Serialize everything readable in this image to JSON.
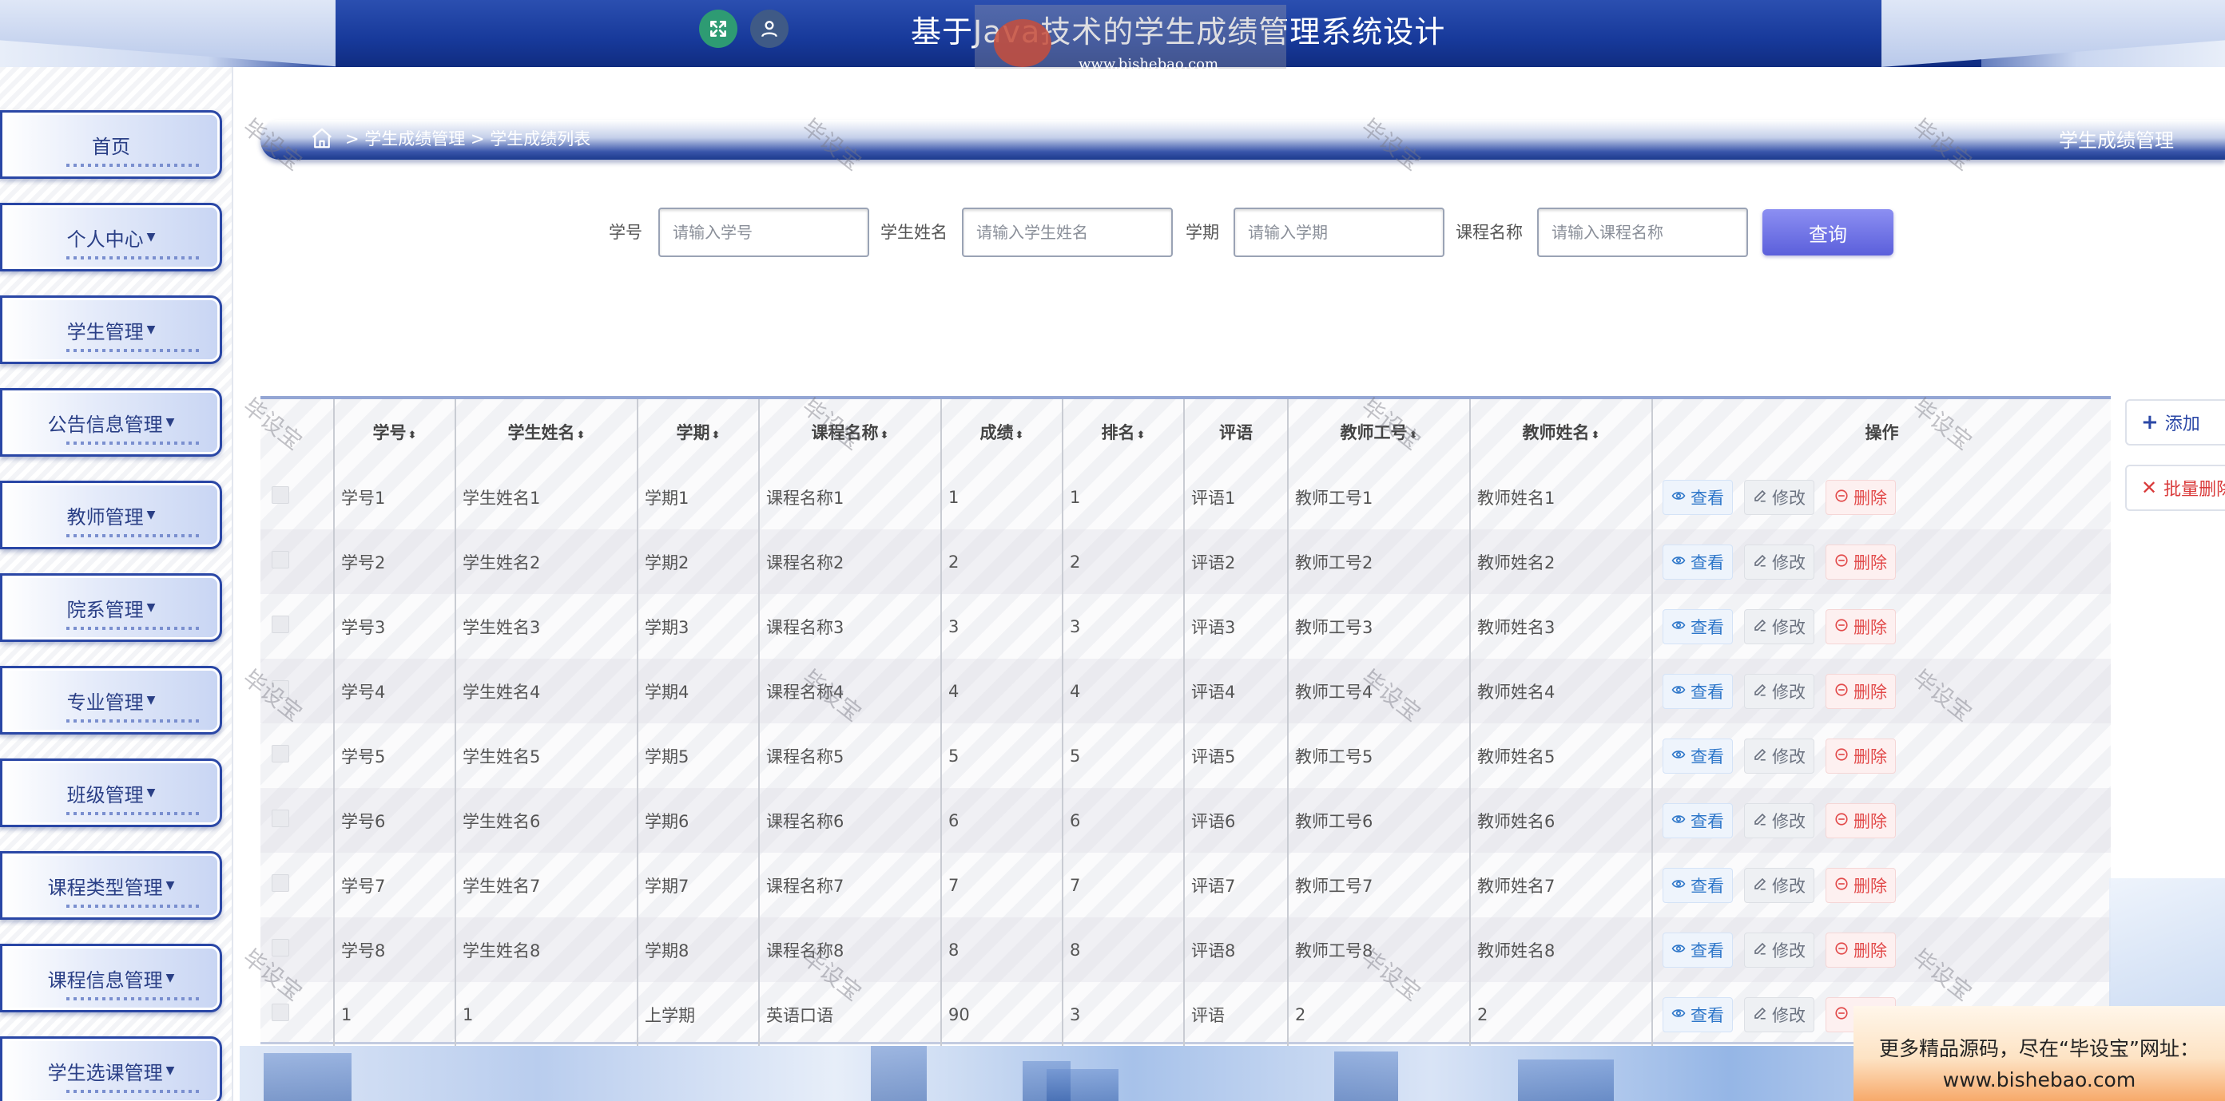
{
  "header": {
    "title": "基于Java技术的学生成绩管理系统设计",
    "watermark_url": "www.bishebao.com"
  },
  "sidebar": {
    "items": [
      {
        "label": "首页",
        "has_caret": false
      },
      {
        "label": "个人中心",
        "has_caret": true
      },
      {
        "label": "学生管理",
        "has_caret": true
      },
      {
        "label": "公告信息管理",
        "has_caret": true
      },
      {
        "label": "教师管理",
        "has_caret": true
      },
      {
        "label": "院系管理",
        "has_caret": true
      },
      {
        "label": "专业管理",
        "has_caret": true
      },
      {
        "label": "班级管理",
        "has_caret": true
      },
      {
        "label": "课程类型管理",
        "has_caret": true
      },
      {
        "label": "课程信息管理",
        "has_caret": true
      },
      {
        "label": "学生选课管理",
        "has_caret": true
      }
    ]
  },
  "breadcrumb": {
    "path": "> 学生成绩管理 > 学生成绩列表",
    "title": "学生成绩管理"
  },
  "search": {
    "fields": [
      {
        "label": "学号",
        "placeholder": "请输入学号",
        "value": ""
      },
      {
        "label": "学生姓名",
        "placeholder": "请输入学生姓名",
        "value": ""
      },
      {
        "label": "学期",
        "placeholder": "请输入学期",
        "value": ""
      },
      {
        "label": "课程名称",
        "placeholder": "请输入课程名称",
        "value": ""
      }
    ],
    "query_label": "查询"
  },
  "actions": {
    "add_label": "添加",
    "batch_delete_label": "批量删除"
  },
  "table": {
    "columns": [
      "学号",
      "学生姓名",
      "学期",
      "课程名称",
      "成绩",
      "排名",
      "评语",
      "教师工号",
      "教师姓名",
      "操作"
    ],
    "sortable": [
      true,
      true,
      true,
      true,
      true,
      true,
      false,
      true,
      true,
      false
    ],
    "rows": [
      [
        "学号1",
        "学生姓名1",
        "学期1",
        "课程名称1",
        "1",
        "1",
        "评语1",
        "教师工号1",
        "教师姓名1"
      ],
      [
        "学号2",
        "学生姓名2",
        "学期2",
        "课程名称2",
        "2",
        "2",
        "评语2",
        "教师工号2",
        "教师姓名2"
      ],
      [
        "学号3",
        "学生姓名3",
        "学期3",
        "课程名称3",
        "3",
        "3",
        "评语3",
        "教师工号3",
        "教师姓名3"
      ],
      [
        "学号4",
        "学生姓名4",
        "学期4",
        "课程名称4",
        "4",
        "4",
        "评语4",
        "教师工号4",
        "教师姓名4"
      ],
      [
        "学号5",
        "学生姓名5",
        "学期5",
        "课程名称5",
        "5",
        "5",
        "评语5",
        "教师工号5",
        "教师姓名5"
      ],
      [
        "学号6",
        "学生姓名6",
        "学期6",
        "课程名称6",
        "6",
        "6",
        "评语6",
        "教师工号6",
        "教师姓名6"
      ],
      [
        "学号7",
        "学生姓名7",
        "学期7",
        "课程名称7",
        "7",
        "7",
        "评语7",
        "教师工号7",
        "教师姓名7"
      ],
      [
        "学号8",
        "学生姓名8",
        "学期8",
        "课程名称8",
        "8",
        "8",
        "评语8",
        "教师工号8",
        "教师姓名8"
      ],
      [
        "1",
        "1",
        "上学期",
        "英语口语",
        "90",
        "3",
        "评语",
        "2",
        "2"
      ]
    ],
    "row_actions": {
      "view": "查看",
      "edit": "修改",
      "delete": "删除"
    }
  },
  "promo": {
    "line1": "更多精品源码，尽在“毕设宝”网址：",
    "line2": "www.bishebao.com"
  },
  "watermark_text": "毕设宝",
  "colors": {
    "brand_blue": "#1e3f9a",
    "query_button": "#6b6fe4",
    "view_blue": "#2d76c9",
    "delete_red": "#e24a4a"
  }
}
